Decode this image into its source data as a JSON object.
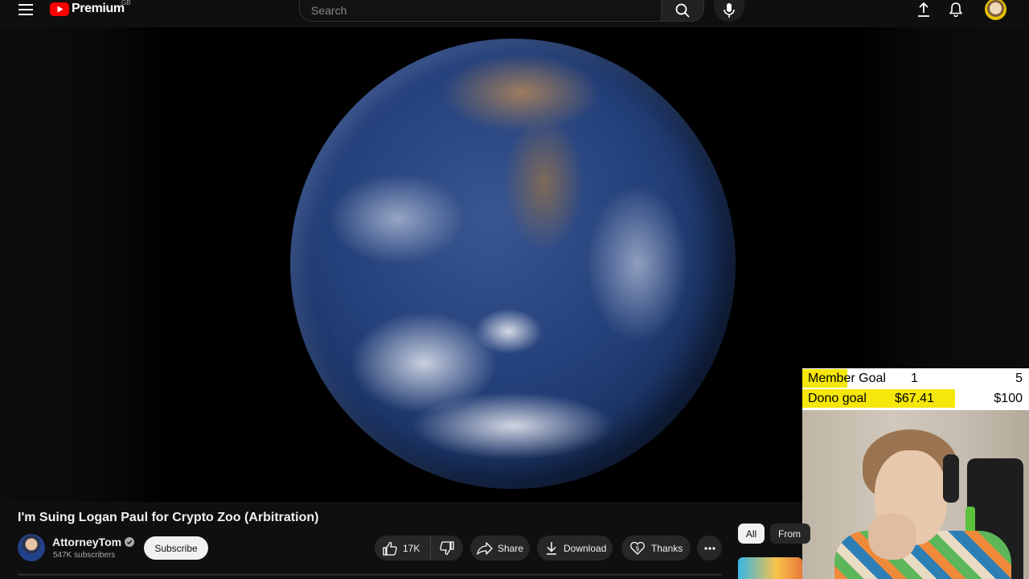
{
  "topbar": {
    "logo_text": "Premium",
    "region": "GB",
    "search_placeholder": "Search",
    "icons": [
      "menu-icon",
      "youtube-logo-icon",
      "search-icon",
      "microphone-icon",
      "upload-icon",
      "bell-icon"
    ]
  },
  "overlay": {
    "member_goal_label": "Member Goal",
    "member_goal_current": "1",
    "member_goal_target": "5",
    "member_goal_fraction": 0.2,
    "dono_goal_label": "Dono goal",
    "dono_goal_current": "$67.41",
    "dono_goal_target": "$100",
    "dono_goal_fraction": 0.6741,
    "fill_color": "#f5e70a"
  },
  "video": {
    "title": "I'm Suing Logan Paul for Crypto Zoo (Arbitration)"
  },
  "channel": {
    "name": "AttorneyTom",
    "subscribers": "547K subscribers",
    "subscribe_label": "Subscribe"
  },
  "actions": {
    "likes": "17K",
    "share_label": "Share",
    "download_label": "Download",
    "thanks_label": "Thanks"
  },
  "chips": {
    "all": "All",
    "from": "From"
  }
}
